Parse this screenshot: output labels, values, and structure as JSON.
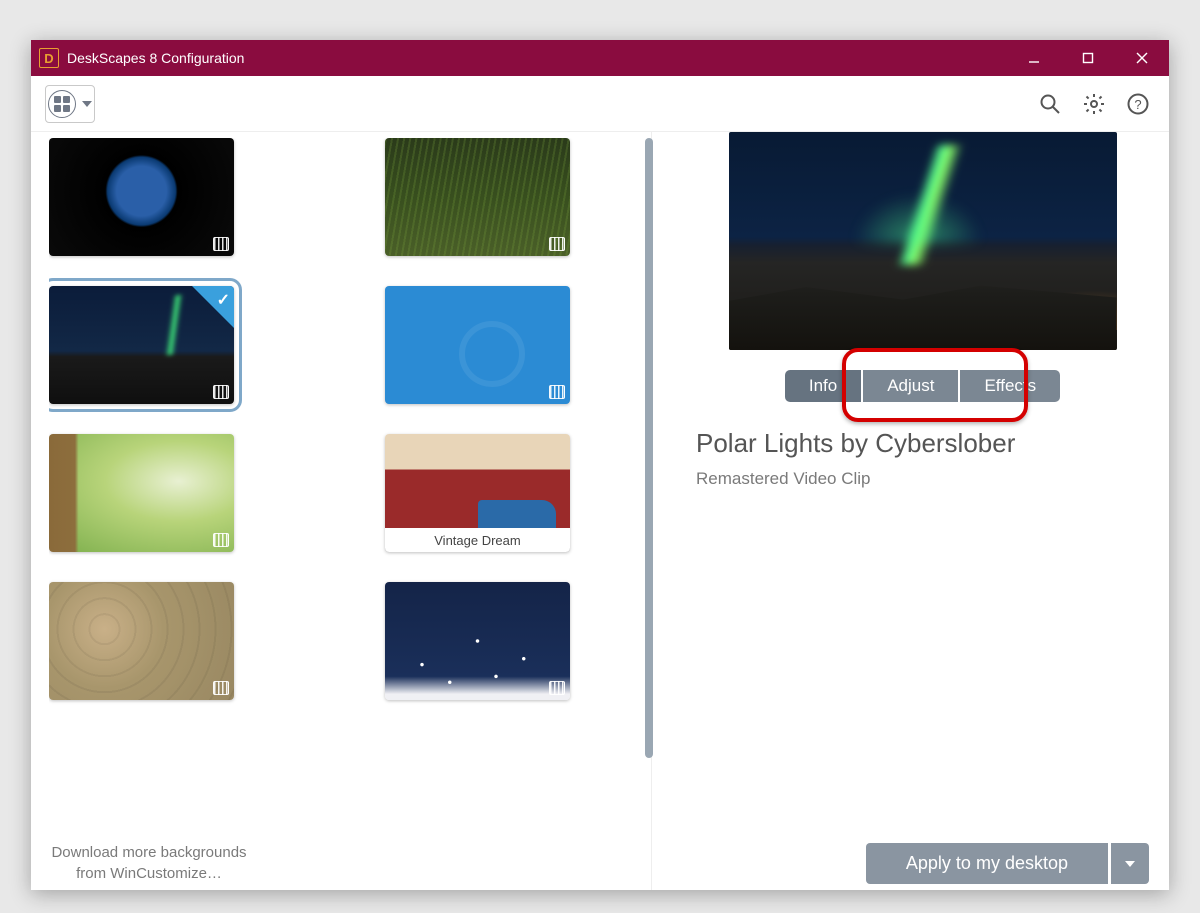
{
  "window": {
    "title": "DeskScapes 8 Configuration"
  },
  "gallery": {
    "items": [
      {
        "id": "earth",
        "video": true,
        "caption": "",
        "selected": false
      },
      {
        "id": "grass",
        "video": true,
        "caption": "",
        "selected": false
      },
      {
        "id": "aurora",
        "video": true,
        "caption": "",
        "selected": true
      },
      {
        "id": "blue",
        "video": true,
        "caption": "",
        "selected": false
      },
      {
        "id": "wood",
        "video": true,
        "caption": "",
        "selected": false
      },
      {
        "id": "vintage",
        "video": false,
        "caption": "Vintage Dream",
        "selected": false
      },
      {
        "id": "sand",
        "video": true,
        "caption": "",
        "selected": false
      },
      {
        "id": "snow",
        "video": true,
        "caption": "",
        "selected": false
      }
    ],
    "download_more": "Download more backgrounds from WinCustomize…"
  },
  "detail": {
    "tabs": {
      "info": "Info",
      "adjust": "Adjust",
      "effects": "Effects",
      "active": "info"
    },
    "title": "Polar Lights by Cyberslober",
    "subtitle": "Remastered Video Clip",
    "apply_label": "Apply to my desktop"
  },
  "colors": {
    "titlebar": "#8a0c3f",
    "tab_bg": "#7b8793",
    "annotation": "#d40000"
  }
}
